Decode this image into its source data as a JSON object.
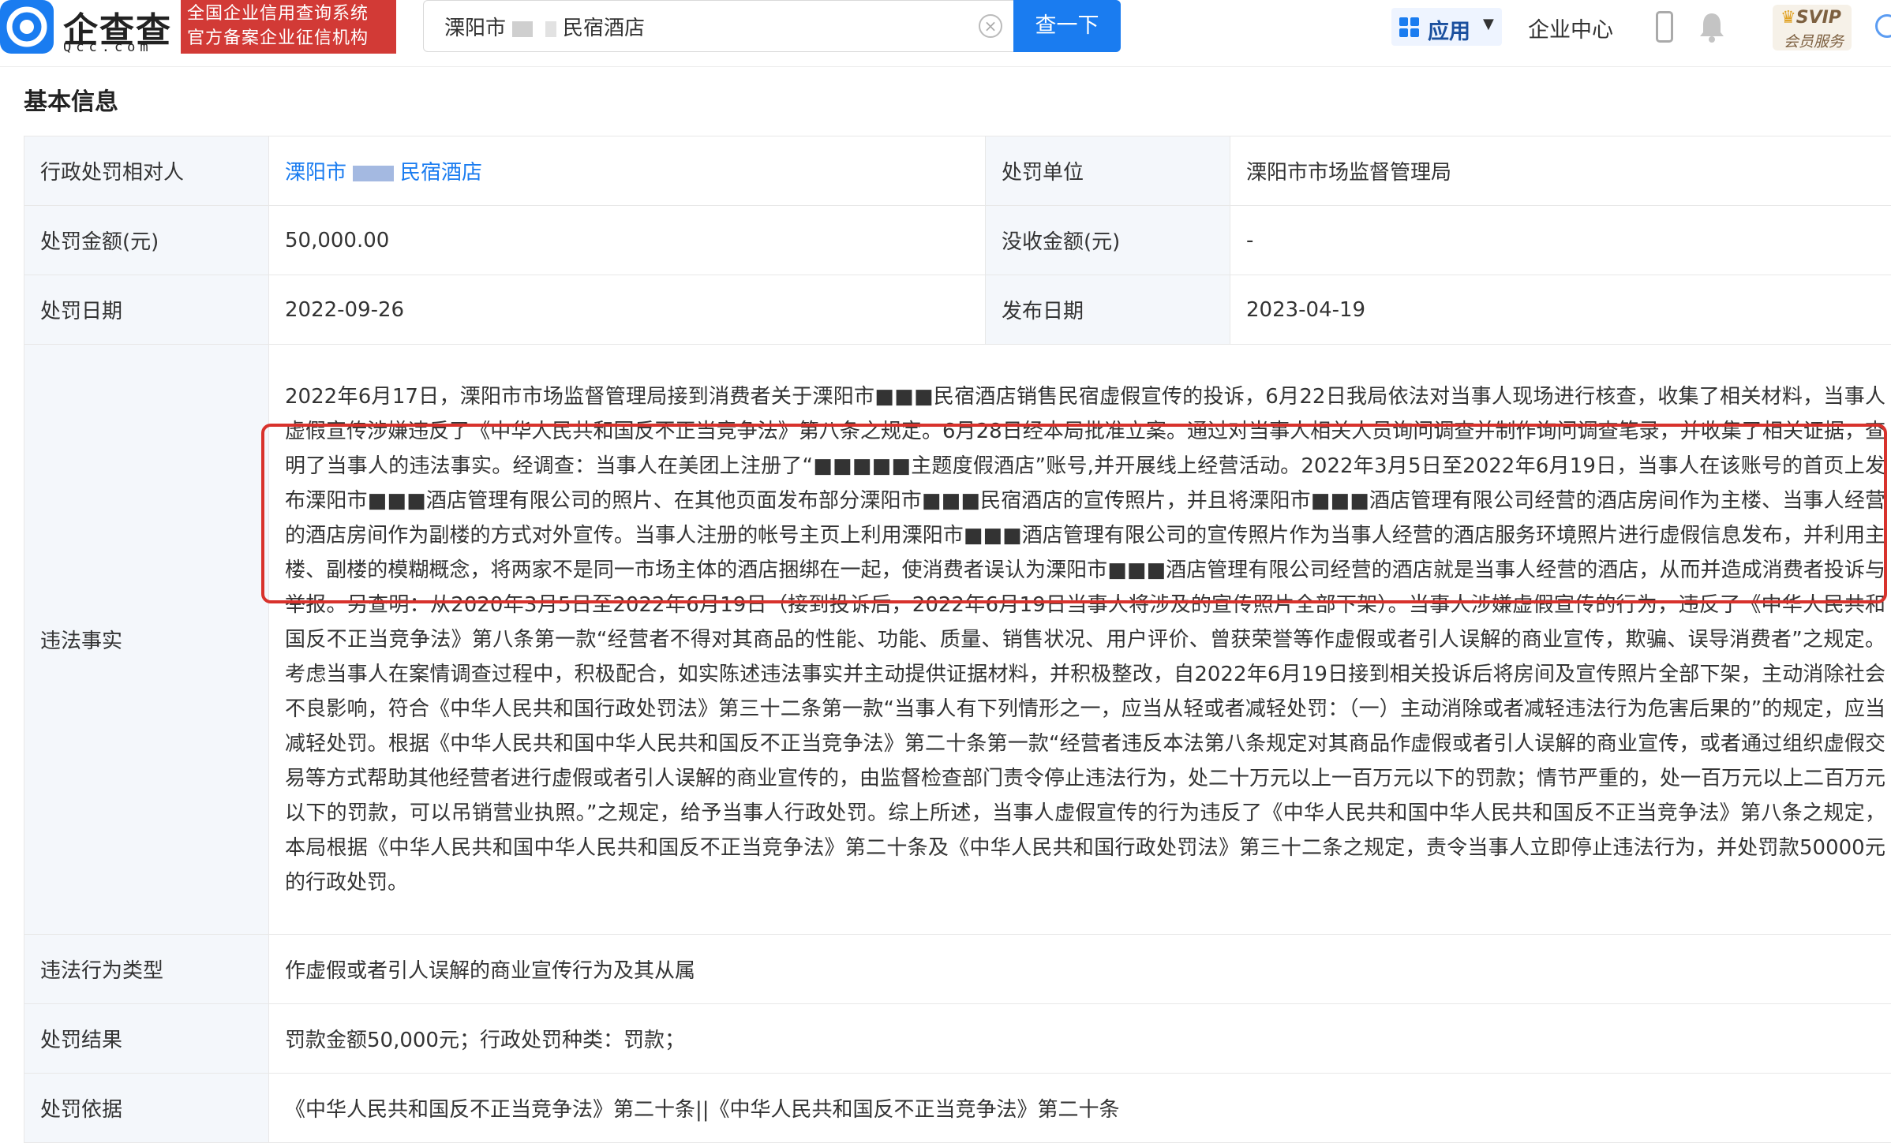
{
  "header": {
    "logo_text": "企查查",
    "logo_sub": "Qcc.com",
    "slogan_line1": "全国企业信用查询系统",
    "slogan_line2": "官方备案企业征信机构",
    "search_value_prefix": "溧阳市",
    "search_value_suffix": "民宿酒店",
    "search_button": "查一下",
    "apps_label": "应用",
    "enterprise_center": "企业中心",
    "svip_top": "SVIP",
    "svip_bottom": "会员服务"
  },
  "section_title": "基本信息",
  "rows": {
    "party_label": "行政处罚相对人",
    "party_prefix": "溧阳市",
    "party_suffix": "民宿酒店",
    "unit_label": "处罚单位",
    "unit_value": "溧阳市市场监督管理局",
    "amount_label": "处罚金额(元)",
    "amount_value": "50,000.00",
    "confiscated_label": "没收金额(元)",
    "confiscated_value": "-",
    "date_label": "处罚日期",
    "date_value": "2022-09-26",
    "publish_label": "发布日期",
    "publish_value": "2023-04-19",
    "facts_label": "违法事实",
    "facts_value": "2022年6月17日，溧阳市市场监督管理局接到消费者关于溧阳市■■■民宿酒店销售民宿虚假宣传的投诉，6月22日我局依法对当事人现场进行核查，收集了相关材料，当事人虚假宣传涉嫌违反了《中华人民共和国反不正当竞争法》第八条之规定。6月28日经本局批准立案。通过对当事人相关人员询问调查并制作询问调查笔录，并收集了相关证据，查明了当事人的违法事实。经调查：当事人在美团上注册了“■■■■■主题度假酒店”账号,并开展线上经营活动。2022年3月5日至2022年6月19日，当事人在该账号的首页上发布溧阳市■■■酒店管理有限公司的照片、在其他页面发布部分溧阳市■■■民宿酒店的宣传照片，并且将溧阳市■■■酒店管理有限公司经营的酒店房间作为主楼、当事人经营的酒店房间作为副楼的方式对外宣传。当事人注册的帐号主页上利用溧阳市■■■酒店管理有限公司的宣传照片作为当事人经营的酒店服务环境照片进行虚假信息发布，并利用主楼、副楼的模糊概念，将两家不是同一市场主体的酒店捆绑在一起，使消费者误认为溧阳市■■■酒店管理有限公司经营的酒店就是当事人经营的酒店，从而并造成消费者投诉与举报。另查明：从2020年3月5日至2022年6月19日（接到投诉后，2022年6月19日当事人将涉及的宣传照片全部下架）。当事人涉嫌虚假宣传的行为，违反了《中华人民共和国反不正当竞争法》第八条第一款“经营者不得对其商品的性能、功能、质量、销售状况、用户评价、曾获荣誉等作虚假或者引人误解的商业宣传，欺骗、误导消费者”之规定。考虑当事人在案情调查过程中，积极配合，如实陈述违法事实并主动提供证据材料，并积极整改，自2022年6月19日接到相关投诉后将房间及宣传照片全部下架，主动消除社会不良影响，符合《中华人民共和国行政处罚法》第三十二条第一款“当事人有下列情形之一，应当从轻或者减轻处罚：（一）主动消除或者减轻违法行为危害后果的”的规定，应当减轻处罚。根据《中华人民共和国中华人民共和国反不正当竞争法》第二十条第一款“经营者违反本法第八条规定对其商品作虚假或者引人误解的商业宣传，或者通过组织虚假交易等方式帮助其他经营者进行虚假或者引人误解的商业宣传的，由监督检查部门责令停止违法行为，处二十万元以上一百万元以下的罚款；情节严重的，处一百万元以上二百万元以下的罚款，可以吊销营业执照。”之规定，给予当事人行政处罚。综上所述，当事人虚假宣传的行为违反了《中华人民共和国中华人民共和国反不正当竞争法》第八条之规定，本局根据《中华人民共和国中华人民共和国反不正当竞争法》第二十条及《中华人民共和国行政处罚法》第三十二条之规定，责令当事人立即停止违法行为，并处罚款50000元的行政处罚。",
    "type_label": "违法行为类型",
    "type_value": "作虚假或者引人误解的商业宣传行为及其从属",
    "result_label": "处罚结果",
    "result_value": "罚款金额50,000元；行政处罚种类：罚款；",
    "basis_label": "处罚依据",
    "basis_value": "《中华人民共和国反不正当竞争法》第二十条||《中华人民共和国反不正当竞争法》第二十条"
  },
  "colors": {
    "brand_blue": "#1a7cf0",
    "brand_red": "#d23a36",
    "highlight_red": "#d8322c",
    "label_bg": "#f4f7fb"
  }
}
